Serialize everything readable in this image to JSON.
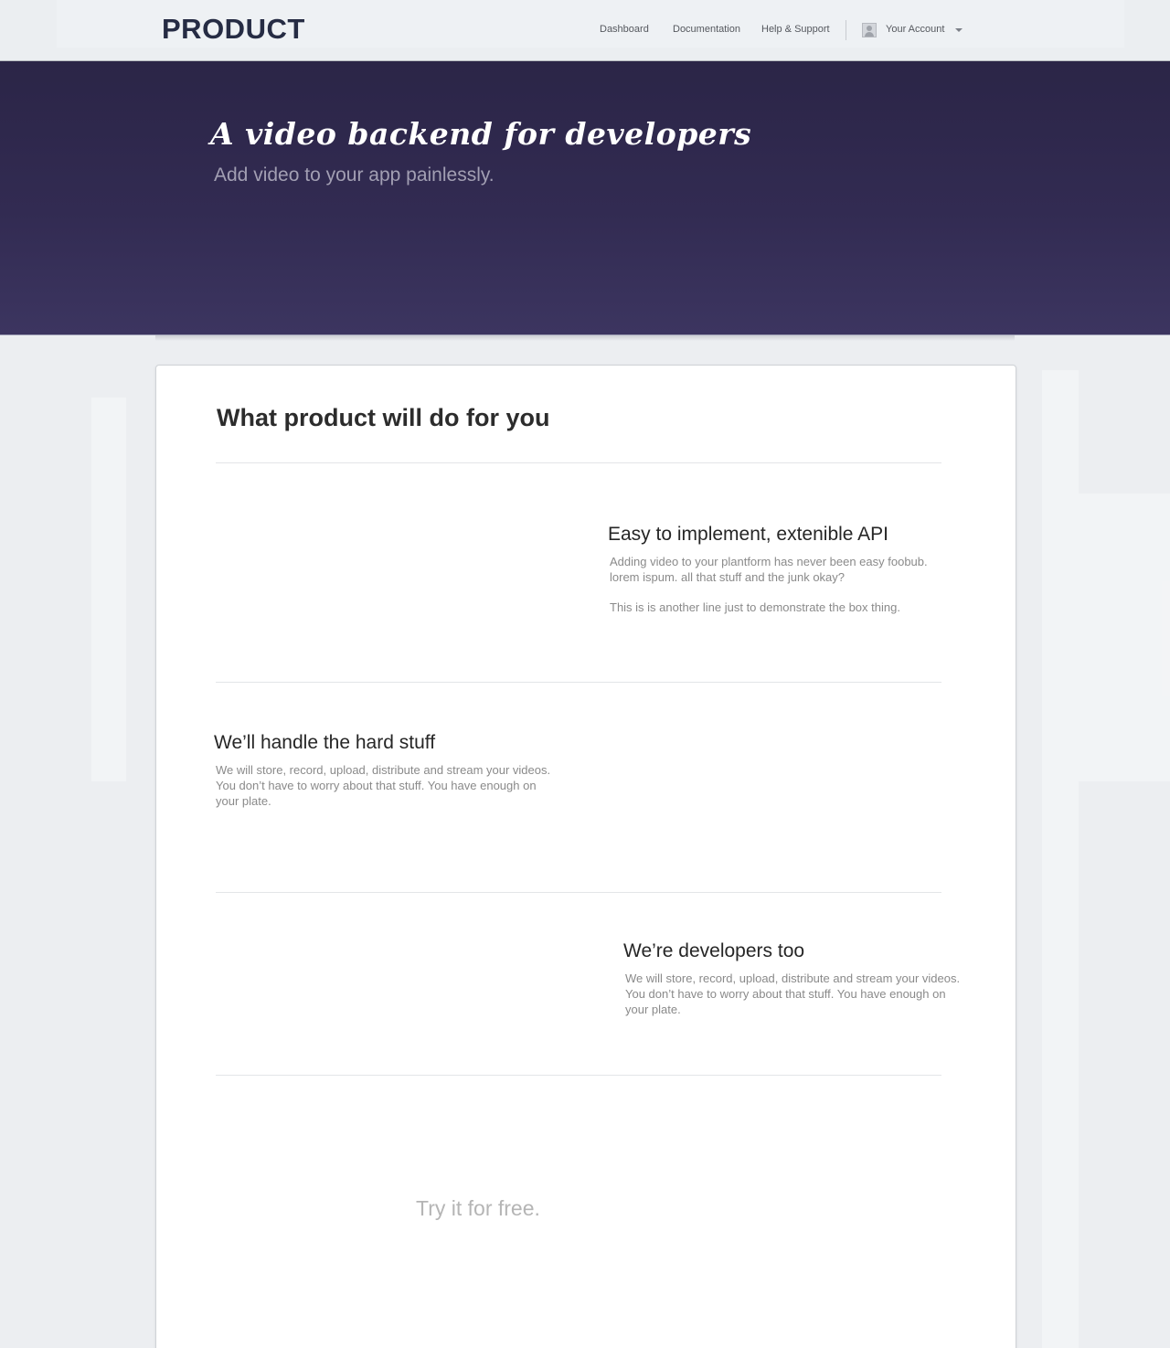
{
  "header": {
    "brand": "PRODUCT",
    "nav": [
      {
        "label": "Dashboard"
      },
      {
        "label": "Documentation"
      },
      {
        "label": "Help & Support"
      }
    ],
    "account_label": "Your Account"
  },
  "hero": {
    "title": "A video backend for developers",
    "subtitle": "Add video to your app painlessly."
  },
  "main": {
    "section_title": "What product will do for you",
    "features": [
      {
        "title": "Easy to implement, extenible API",
        "paragraphs": [
          "Adding video to your plantform has never been easy foobub. lorem ispum. all that stuff and the junk okay?",
          "This is is another line just to demonstrate the box thing."
        ]
      },
      {
        "title": "We’ll handle the hard stuff",
        "paragraphs": [
          "We will store, record, upload, distribute and stream your videos. You don’t have to worry about that stuff. You have enough on your plate."
        ]
      },
      {
        "title": "We’re developers too",
        "paragraphs": [
          "We will store, record, upload, distribute and stream your videos. You don’t have to worry about that stuff. You have enough on your plate."
        ]
      }
    ],
    "cta": "Try it for free."
  },
  "colors": {
    "hero_background": "#2b2547",
    "brand_text": "#262c44",
    "page_background": "#eceef1"
  }
}
